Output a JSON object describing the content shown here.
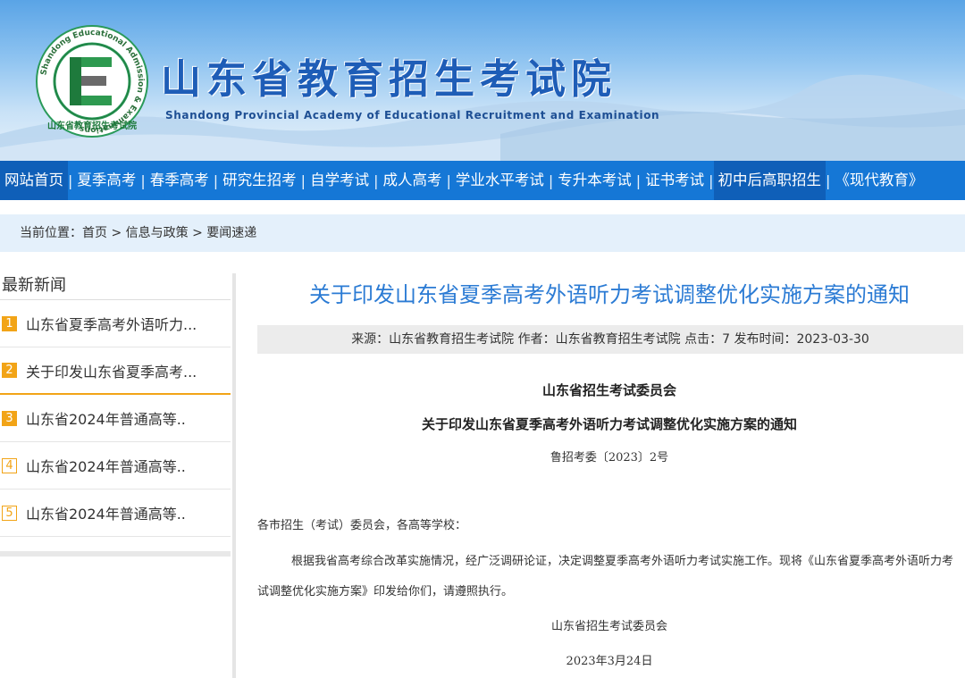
{
  "header": {
    "title": "山东省教育招生考试院",
    "subtitle": "Shandong Provincial Academy of Educational Recruitment and Examination",
    "logo_ring_text": "Shandong Educational Admission & Examinations",
    "logo_bottom_text": "山东省教育招生考试院"
  },
  "nav": {
    "items": [
      {
        "label": "网站首页"
      },
      {
        "label": "夏季高考"
      },
      {
        "label": "春季高考"
      },
      {
        "label": "研究生招考"
      },
      {
        "label": "自学考试"
      },
      {
        "label": "成人高考"
      },
      {
        "label": "学业水平考试"
      },
      {
        "label": "专升本考试"
      },
      {
        "label": "证书考试"
      },
      {
        "label": "初中后高职招生"
      },
      {
        "label": "《现代教育》"
      }
    ]
  },
  "breadcrumb": {
    "prefix": "当前位置：",
    "items": [
      "首页",
      "信息与政策",
      "要闻速递"
    ],
    "separator": " > "
  },
  "sidebar": {
    "heading": "最新新闻",
    "items": [
      {
        "num": "1",
        "title": "山东省夏季高考外语听力..."
      },
      {
        "num": "2",
        "title": "关于印发山东省夏季高考..."
      },
      {
        "num": "3",
        "title": "山东省2024年普通高等.."
      },
      {
        "num": "4",
        "title": "山东省2024年普通高等.."
      },
      {
        "num": "5",
        "title": "山东省2024年普通高等.."
      }
    ]
  },
  "article": {
    "title": "关于印发山东省夏季高考外语听力考试调整优化实施方案的通知",
    "meta": "来源：山东省教育招生考试院 作者：山东省教育招生考试院 点击：7 发布时间：2023-03-30",
    "doc_org": "山东省招生考试委员会",
    "doc_title": "关于印发山东省夏季高考外语听力考试调整优化实施方案的通知",
    "doc_code": "鲁招考委〔2023〕2号",
    "salutation": "各市招生（考试）委员会，各高等学校：",
    "paragraph": "根据我省高考综合改革实施情况，经广泛调研论证，决定调整夏季高考外语听力考试实施工作。现将《山东省夏季高考外语听力考试调整优化实施方案》印发给你们，请遵照执行。",
    "sign_org": "山东省招生考试委员会",
    "sign_date": "2023年3月24日"
  },
  "colors": {
    "nav_bg": "#1577d6",
    "title_blue": "#2b7bd4",
    "badge_orange": "#f2a417",
    "crumb_bg": "#e4f0fb"
  }
}
